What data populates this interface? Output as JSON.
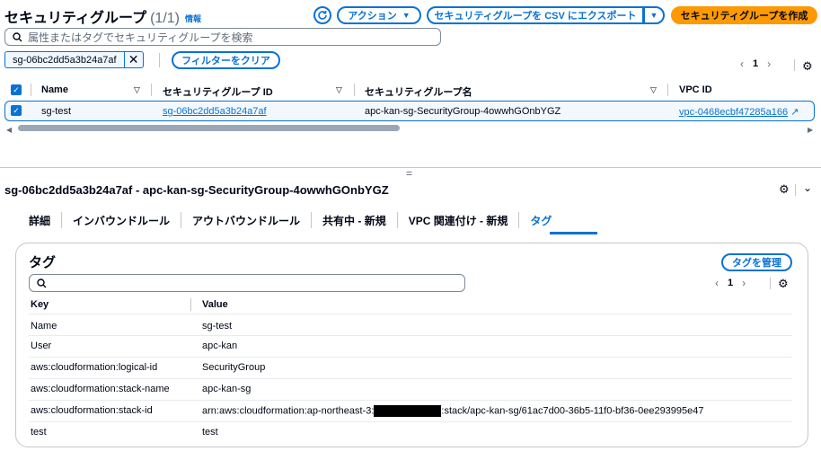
{
  "header": {
    "title": "セキュリティグループ",
    "count": "(1/1)",
    "info": "情報",
    "actions_label": "アクション",
    "export_label": "セキュリティグループを CSV にエクスポート",
    "create_label": "セキュリティグループを作成"
  },
  "search": {
    "placeholder": "属性またはタグでセキュリティグループを検索"
  },
  "filter": {
    "token": "sg-06bc2dd5a3b24a7af",
    "clear_label": "フィルターをクリア"
  },
  "pagination": {
    "page": "1"
  },
  "table": {
    "columns": [
      "Name",
      "セキュリティグループ ID",
      "セキュリティグループ名",
      "VPC ID"
    ],
    "rows": [
      {
        "name": "sg-test",
        "group_id": "sg-06bc2dd5a3b24a7af",
        "group_name": "apc-kan-sg-SecurityGroup-4owwhGOnbYGZ",
        "vpc_id": "vpc-0468ecbf47285a166"
      }
    ]
  },
  "detail": {
    "title": "sg-06bc2dd5a3b24a7af - apc-kan-sg-SecurityGroup-4owwhGOnbYGZ",
    "tabs": [
      "詳細",
      "インバウンドルール",
      "アウトバウンドルール",
      "共有中 - 新規",
      "VPC 関連付け - 新規",
      "タグ"
    ],
    "active_tab": "タグ"
  },
  "tags": {
    "heading": "タグ",
    "manage_label": "タグを管理",
    "page": "1",
    "col_key": "Key",
    "col_value": "Value",
    "rows": [
      {
        "key": "Name",
        "value": "sg-test"
      },
      {
        "key": "User",
        "value": "apc-kan"
      },
      {
        "key": "aws:cloudformation:logical-id",
        "value": "SecurityGroup"
      },
      {
        "key": "aws:cloudformation:stack-name",
        "value": "apc-kan-sg"
      },
      {
        "key": "aws:cloudformation:stack-id",
        "value_prefix": "arn:aws:cloudformation:ap-northeast-3:",
        "value_suffix": ":stack/apc-kan-sg/61ac7d00-36b5-11f0-bf36-0ee293995e47"
      },
      {
        "key": "test",
        "value": "test"
      }
    ]
  },
  "colors": {
    "accent": "#0972d3",
    "primary": "#ff9900",
    "text": "#000716",
    "border": "#c6c6cd"
  }
}
